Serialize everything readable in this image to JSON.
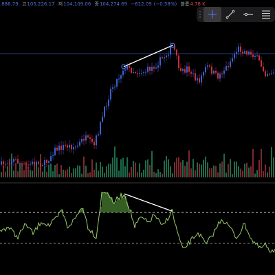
{
  "header": {
    "open_value": ".886.79",
    "high_label": "고",
    "high_value": "105,226.17",
    "low_label": "저",
    "low_value": "104,109.06",
    "close_label": "종",
    "close_value": "104,274.69",
    "change_value": "−612.09",
    "change_pct": "(−0.58%)",
    "volume_label": "볼륨",
    "volume_value": "4.78 K"
  },
  "toolbar": {
    "items": [
      {
        "icon": "crosshair-icon"
      },
      {
        "icon": "trendline-icon"
      },
      {
        "icon": "horizontal-ray-icon"
      },
      {
        "icon": "fib-retracement-icon"
      }
    ]
  },
  "colors": {
    "up": "#3d5fcf",
    "down": "#c9303f",
    "volume_up": "#1f6a4a",
    "volume_down": "#7a2a2e",
    "oscillator": "#9ccb6e",
    "oscillator_fill": "#3f6f2a",
    "drawing": "#ffffff",
    "price_line": "#2b3a8a"
  }
}
